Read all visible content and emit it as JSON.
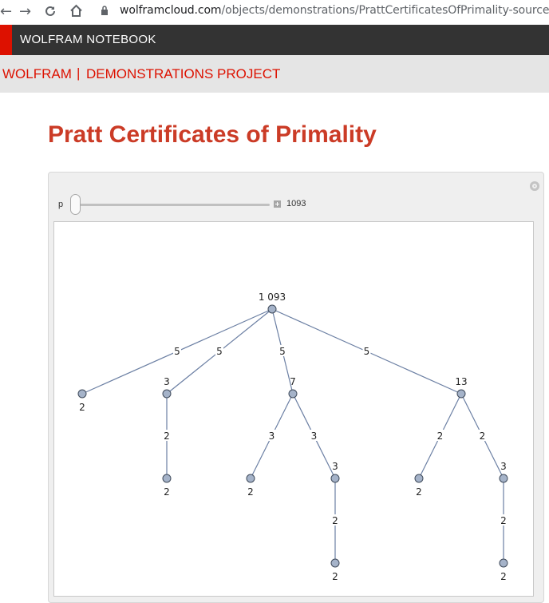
{
  "browser": {
    "back": "←",
    "forward": "→",
    "url_domain": "wolframcloud.com",
    "url_path": "/objects/demonstrations/PrattCertificatesOfPrimality-source.nb"
  },
  "header": {
    "notebook_title": "WOLFRAM NOTEBOOK",
    "brand": "WOLFRAM",
    "separator": "|",
    "section": "DEMONSTRATIONS PROJECT"
  },
  "page": {
    "title": "Pratt Certificates of Primality"
  },
  "controls": {
    "slider_label": "p",
    "slider_value": "1093",
    "slider_position_fraction": 0.0
  },
  "colors": {
    "title": "#cb3b26",
    "brand_red": "#dd1100",
    "node_fill": "#a5b3c9",
    "edge": "#6b7fa3"
  },
  "graph": {
    "nodes": [
      {
        "id": "root",
        "label": "1 093"
      },
      {
        "id": "n2a",
        "label": "2"
      },
      {
        "id": "n3",
        "label": "3"
      },
      {
        "id": "n7",
        "label": "7"
      },
      {
        "id": "n13",
        "label": "13"
      },
      {
        "id": "n2b",
        "label": "2"
      },
      {
        "id": "n2c",
        "label": "2"
      },
      {
        "id": "n3b",
        "label": "3"
      },
      {
        "id": "n2d",
        "label": "2"
      },
      {
        "id": "n3c",
        "label": "3"
      },
      {
        "id": "n2e",
        "label": "2"
      },
      {
        "id": "n2f",
        "label": "2"
      }
    ],
    "edges": [
      {
        "from": "root",
        "to": "n2a",
        "label": "5"
      },
      {
        "from": "root",
        "to": "n3",
        "label": "5"
      },
      {
        "from": "root",
        "to": "n7",
        "label": "5"
      },
      {
        "from": "root",
        "to": "n13",
        "label": "5"
      },
      {
        "from": "n3",
        "to": "n2b",
        "label": "2"
      },
      {
        "from": "n7",
        "to": "n2c",
        "label": "3"
      },
      {
        "from": "n7",
        "to": "n3b",
        "label": "3"
      },
      {
        "from": "n13",
        "to": "n2d",
        "label": "2"
      },
      {
        "from": "n13",
        "to": "n3c",
        "label": "2"
      },
      {
        "from": "n3b",
        "to": "n2e",
        "label": "2"
      },
      {
        "from": "n3c",
        "to": "n2f",
        "label": "2"
      }
    ]
  }
}
